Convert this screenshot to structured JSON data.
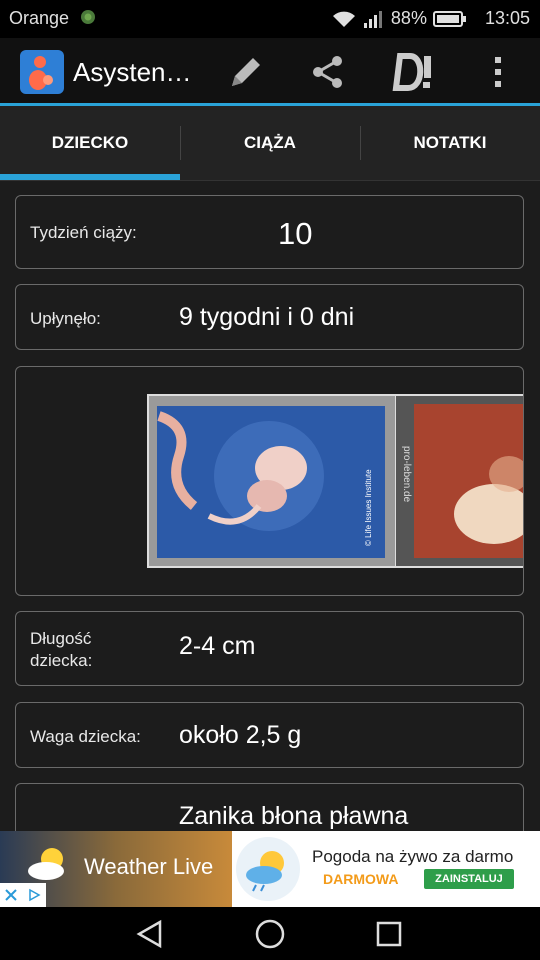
{
  "status": {
    "carrier": "Orange",
    "battery": "88%",
    "time": "13:05"
  },
  "appbar": {
    "title": "Asysten…"
  },
  "tabs": [
    {
      "label": "DZIECKO"
    },
    {
      "label": "CIĄŻA"
    },
    {
      "label": "NOTATKI"
    }
  ],
  "week": {
    "label": "Tydzień ciąży:",
    "value": "10"
  },
  "elapsed": {
    "label": "Upłynęło:",
    "value": "9 tygodni i 0 dni"
  },
  "image": {
    "credit": "© Life Issues Institute",
    "watermark": "pro-leben.de"
  },
  "length": {
    "label_line1": "Długość",
    "label_line2": "dziecka:",
    "value": "2-4 cm"
  },
  "weight": {
    "label": "Waga dziecka:",
    "value": "około 2,5 g"
  },
  "fact": {
    "value": "Zanika błona pławna"
  },
  "ad": {
    "brand": "Weather Live",
    "headline": "Pogoda na żywo za darmo",
    "free": "DARMOWA",
    "install": "ZAINSTALUJ"
  }
}
